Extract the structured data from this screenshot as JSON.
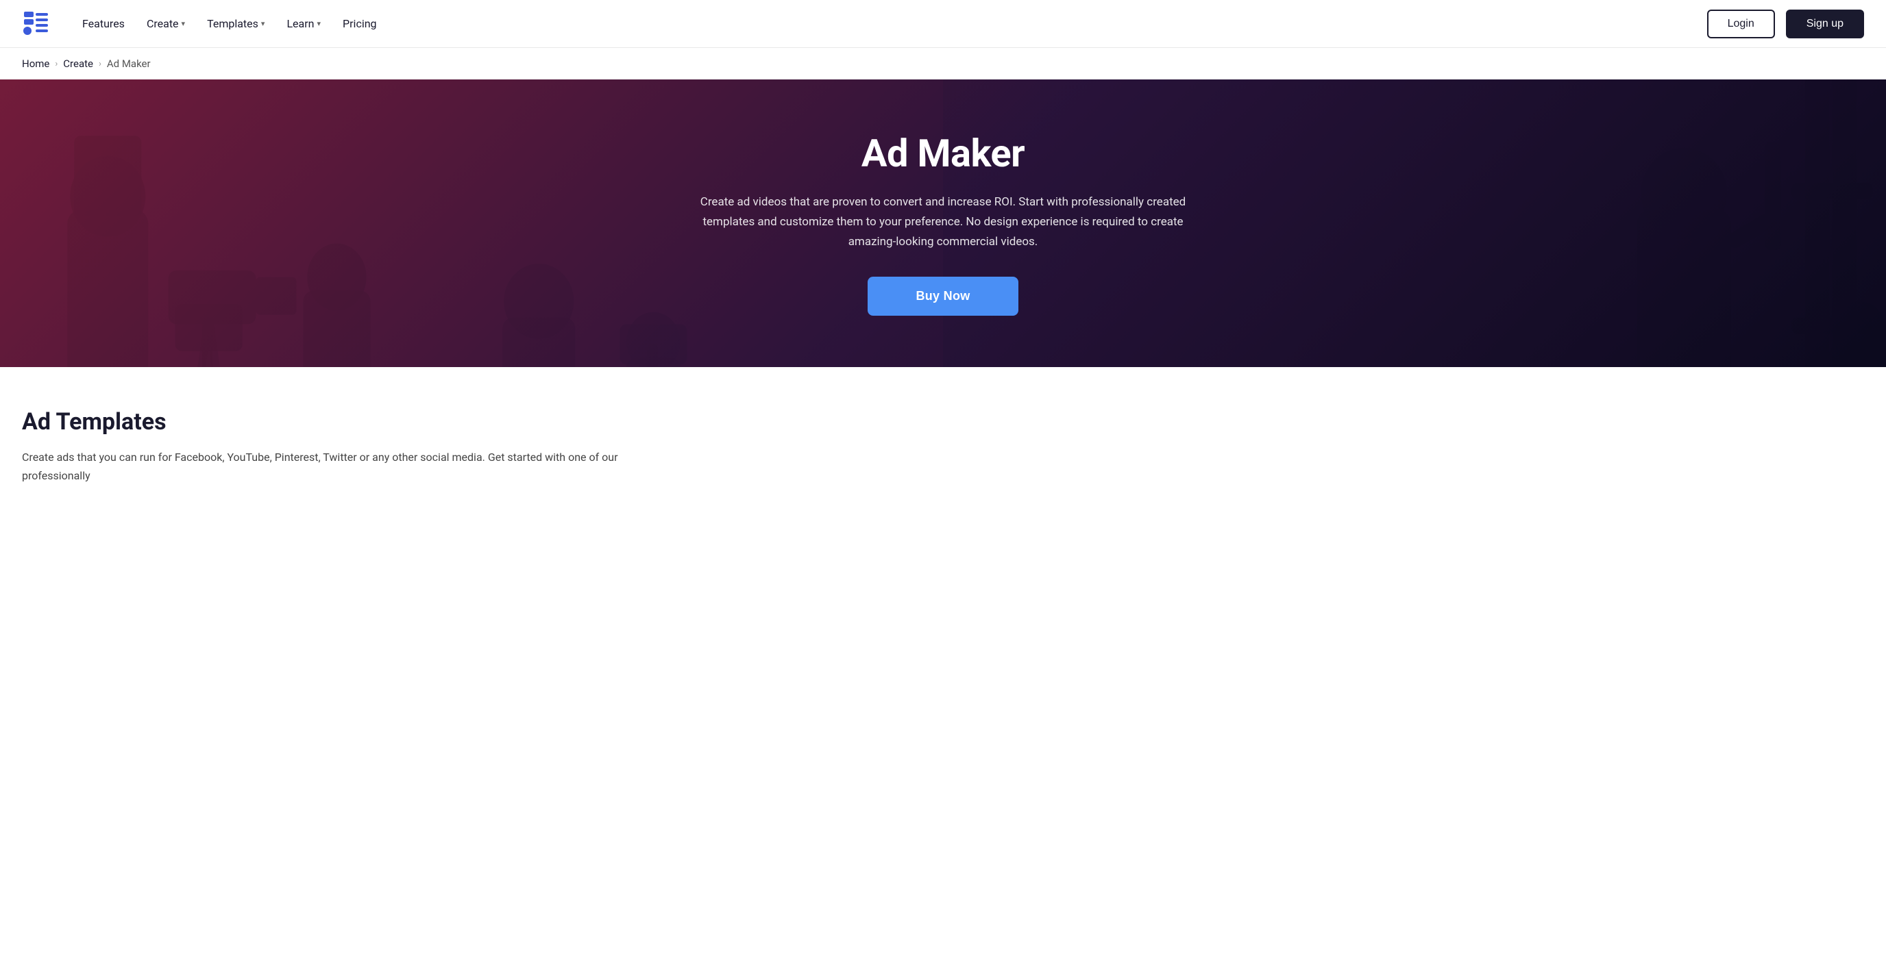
{
  "nav": {
    "features_label": "Features",
    "create_label": "Create",
    "templates_label": "Templates",
    "learn_label": "Learn",
    "pricing_label": "Pricing",
    "login_label": "Login",
    "signup_label": "Sign up"
  },
  "breadcrumb": {
    "home_label": "Home",
    "create_label": "Create",
    "current_label": "Ad Maker"
  },
  "hero": {
    "title": "Ad Maker",
    "description": "Create ad videos that are proven to convert and increase ROI. Start with professionally created templates and customize them to your preference. No design experience is required to create amazing-looking commercial videos.",
    "cta_label": "Buy Now"
  },
  "below_hero": {
    "section_title": "Ad Templates",
    "section_description": "Create ads that you can run for Facebook, YouTube, Pinterest, Twitter or any other social media. Get started with one of our professionally"
  }
}
